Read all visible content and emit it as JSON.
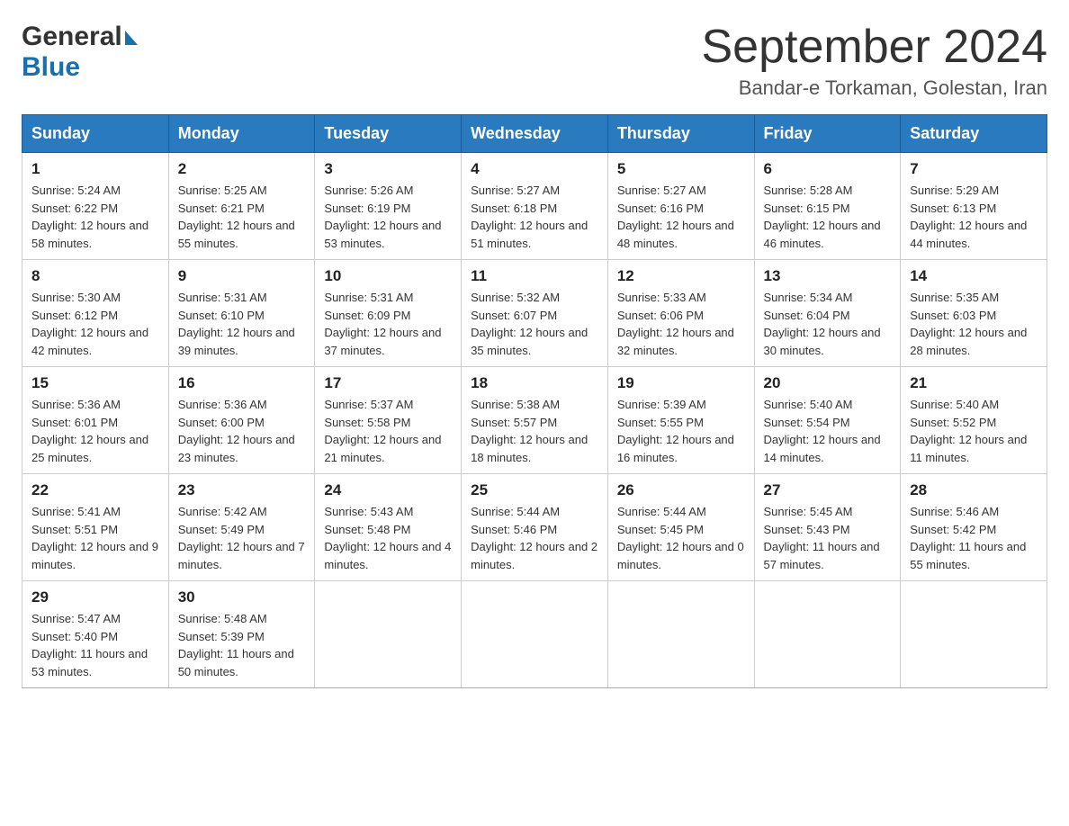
{
  "header": {
    "logo_general": "General",
    "logo_blue": "Blue",
    "month_title": "September 2024",
    "location": "Bandar-e Torkaman, Golestan, Iran"
  },
  "weekdays": [
    "Sunday",
    "Monday",
    "Tuesday",
    "Wednesday",
    "Thursday",
    "Friday",
    "Saturday"
  ],
  "weeks": [
    [
      {
        "day": "1",
        "sunrise": "5:24 AM",
        "sunset": "6:22 PM",
        "daylight": "12 hours and 58 minutes."
      },
      {
        "day": "2",
        "sunrise": "5:25 AM",
        "sunset": "6:21 PM",
        "daylight": "12 hours and 55 minutes."
      },
      {
        "day": "3",
        "sunrise": "5:26 AM",
        "sunset": "6:19 PM",
        "daylight": "12 hours and 53 minutes."
      },
      {
        "day": "4",
        "sunrise": "5:27 AM",
        "sunset": "6:18 PM",
        "daylight": "12 hours and 51 minutes."
      },
      {
        "day": "5",
        "sunrise": "5:27 AM",
        "sunset": "6:16 PM",
        "daylight": "12 hours and 48 minutes."
      },
      {
        "day": "6",
        "sunrise": "5:28 AM",
        "sunset": "6:15 PM",
        "daylight": "12 hours and 46 minutes."
      },
      {
        "day": "7",
        "sunrise": "5:29 AM",
        "sunset": "6:13 PM",
        "daylight": "12 hours and 44 minutes."
      }
    ],
    [
      {
        "day": "8",
        "sunrise": "5:30 AM",
        "sunset": "6:12 PM",
        "daylight": "12 hours and 42 minutes."
      },
      {
        "day": "9",
        "sunrise": "5:31 AM",
        "sunset": "6:10 PM",
        "daylight": "12 hours and 39 minutes."
      },
      {
        "day": "10",
        "sunrise": "5:31 AM",
        "sunset": "6:09 PM",
        "daylight": "12 hours and 37 minutes."
      },
      {
        "day": "11",
        "sunrise": "5:32 AM",
        "sunset": "6:07 PM",
        "daylight": "12 hours and 35 minutes."
      },
      {
        "day": "12",
        "sunrise": "5:33 AM",
        "sunset": "6:06 PM",
        "daylight": "12 hours and 32 minutes."
      },
      {
        "day": "13",
        "sunrise": "5:34 AM",
        "sunset": "6:04 PM",
        "daylight": "12 hours and 30 minutes."
      },
      {
        "day": "14",
        "sunrise": "5:35 AM",
        "sunset": "6:03 PM",
        "daylight": "12 hours and 28 minutes."
      }
    ],
    [
      {
        "day": "15",
        "sunrise": "5:36 AM",
        "sunset": "6:01 PM",
        "daylight": "12 hours and 25 minutes."
      },
      {
        "day": "16",
        "sunrise": "5:36 AM",
        "sunset": "6:00 PM",
        "daylight": "12 hours and 23 minutes."
      },
      {
        "day": "17",
        "sunrise": "5:37 AM",
        "sunset": "5:58 PM",
        "daylight": "12 hours and 21 minutes."
      },
      {
        "day": "18",
        "sunrise": "5:38 AM",
        "sunset": "5:57 PM",
        "daylight": "12 hours and 18 minutes."
      },
      {
        "day": "19",
        "sunrise": "5:39 AM",
        "sunset": "5:55 PM",
        "daylight": "12 hours and 16 minutes."
      },
      {
        "day": "20",
        "sunrise": "5:40 AM",
        "sunset": "5:54 PM",
        "daylight": "12 hours and 14 minutes."
      },
      {
        "day": "21",
        "sunrise": "5:40 AM",
        "sunset": "5:52 PM",
        "daylight": "12 hours and 11 minutes."
      }
    ],
    [
      {
        "day": "22",
        "sunrise": "5:41 AM",
        "sunset": "5:51 PM",
        "daylight": "12 hours and 9 minutes."
      },
      {
        "day": "23",
        "sunrise": "5:42 AM",
        "sunset": "5:49 PM",
        "daylight": "12 hours and 7 minutes."
      },
      {
        "day": "24",
        "sunrise": "5:43 AM",
        "sunset": "5:48 PM",
        "daylight": "12 hours and 4 minutes."
      },
      {
        "day": "25",
        "sunrise": "5:44 AM",
        "sunset": "5:46 PM",
        "daylight": "12 hours and 2 minutes."
      },
      {
        "day": "26",
        "sunrise": "5:44 AM",
        "sunset": "5:45 PM",
        "daylight": "12 hours and 0 minutes."
      },
      {
        "day": "27",
        "sunrise": "5:45 AM",
        "sunset": "5:43 PM",
        "daylight": "11 hours and 57 minutes."
      },
      {
        "day": "28",
        "sunrise": "5:46 AM",
        "sunset": "5:42 PM",
        "daylight": "11 hours and 55 minutes."
      }
    ],
    [
      {
        "day": "29",
        "sunrise": "5:47 AM",
        "sunset": "5:40 PM",
        "daylight": "11 hours and 53 minutes."
      },
      {
        "day": "30",
        "sunrise": "5:48 AM",
        "sunset": "5:39 PM",
        "daylight": "11 hours and 50 minutes."
      },
      null,
      null,
      null,
      null,
      null
    ]
  ],
  "labels": {
    "sunrise_prefix": "Sunrise: ",
    "sunset_prefix": "Sunset: ",
    "daylight_prefix": "Daylight: "
  }
}
